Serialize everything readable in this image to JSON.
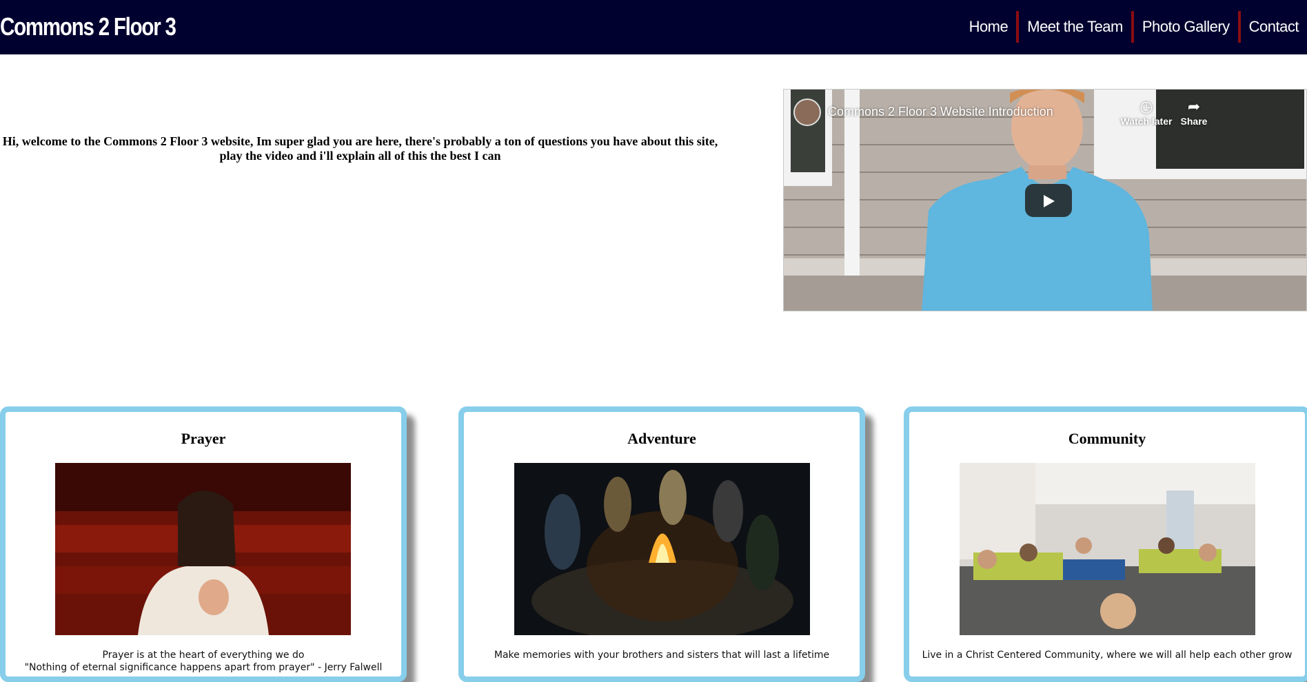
{
  "header": {
    "brand": "Commons 2 Floor 3",
    "nav": [
      "Home",
      "Meet the Team",
      "Photo Gallery",
      "Contact"
    ]
  },
  "intro": {
    "text": "Hi, welcome to the Commons 2 Floor 3 website, Im super glad you are here, there's probably a ton of questions you have about this site, play the video and i'll explain all of this the best I can"
  },
  "video": {
    "title": "Commons 2 Floor 3 Website Introduction",
    "watch_later": "Watch later",
    "share": "Share"
  },
  "cards": [
    {
      "title": "Prayer",
      "lines": [
        "Prayer is at the heart of everything we do",
        "\"Nothing of eternal significance happens apart from prayer\" - Jerry Falwell"
      ]
    },
    {
      "title": "Adventure",
      "lines": [
        "Make memories with your brothers and sisters that will last a lifetime"
      ]
    },
    {
      "title": "Community",
      "lines": [
        "Live in a Christ Centered Community, where we will all help each other grow"
      ]
    }
  ],
  "colors": {
    "navbar": "#01012f",
    "nav_separator": "#8b0d12",
    "card_border": "#87ceeb"
  }
}
